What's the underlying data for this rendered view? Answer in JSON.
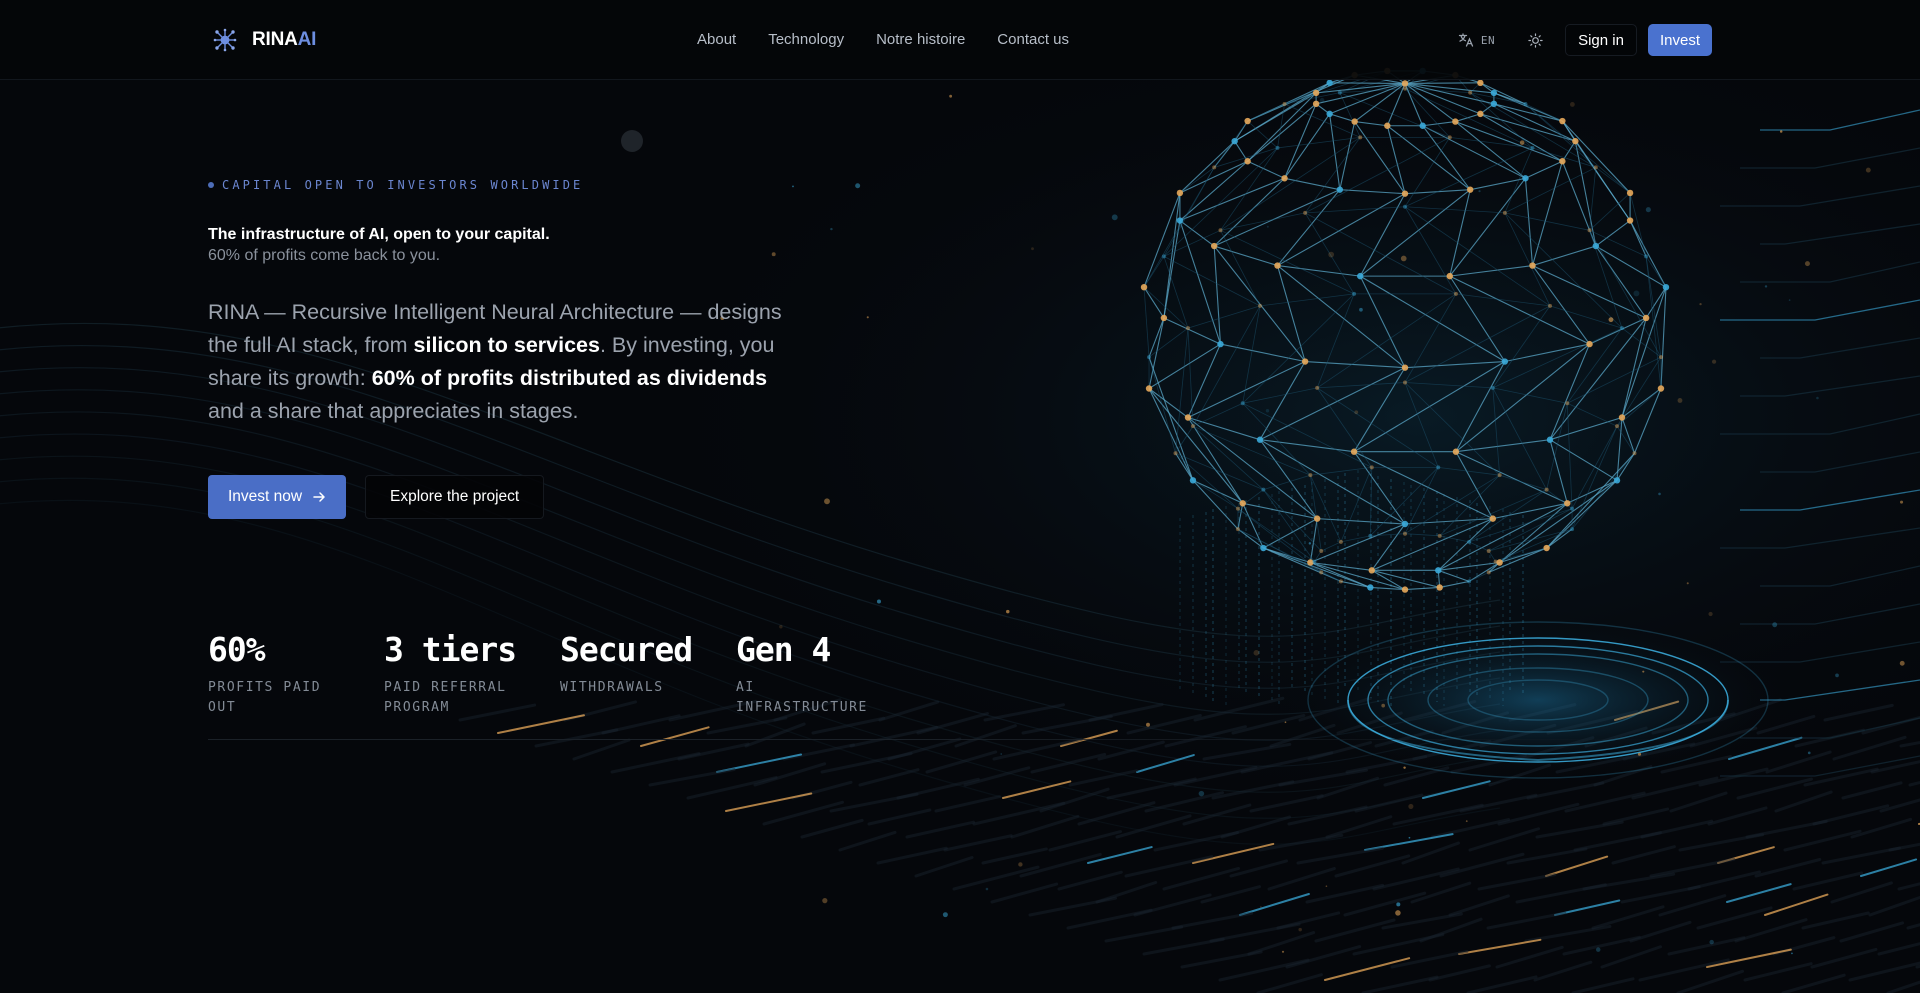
{
  "header": {
    "brand": {
      "name_main": "RINA",
      "name_accent": "AI",
      "logo_icon": "network-node-icon"
    },
    "nav": [
      {
        "label": "About"
      },
      {
        "label": "Technology"
      },
      {
        "label": "Notre histoire"
      },
      {
        "label": "Contact us"
      }
    ],
    "language": {
      "icon": "translate-icon",
      "code": "EN"
    },
    "theme_toggle_icon": "sun-icon",
    "sign_in_label": "Sign in",
    "invest_label": "Invest"
  },
  "hero": {
    "eyebrow": "CAPITAL OPEN TO INVESTORS WORLDWIDE",
    "headline_1": "The infrastructure of AI, open to your capital.",
    "headline_2": "60% of profits come back to you.",
    "lead": {
      "part_1": "RINA — Recursive Intelligent Neural Architecture — designs the full AI stack, from ",
      "highlight_1": "silicon to services",
      "part_2": ". By investing, you share its growth: ",
      "highlight_2": "60% of profits distributed as dividends",
      "part_3": " and a share that appreciates in stages."
    },
    "cta_primary": "Invest now",
    "cta_primary_icon": "arrow-right-icon",
    "cta_secondary": "Explore the project"
  },
  "stats": [
    {
      "value": "60%",
      "label": "PROFITS PAID OUT"
    },
    {
      "value": "3 tiers",
      "label": "PAID REFERRAL PROGRAM"
    },
    {
      "value": "Secured",
      "label": "WITHDRAWALS"
    },
    {
      "value": "Gen 4",
      "label": "AI INFRASTRUCTURE"
    }
  ],
  "colors": {
    "background": "#05070b",
    "accent": "#4a72cf",
    "accent_text": "#6d8ee0",
    "globe_cyan": "#3aa9d8",
    "node_amber": "#e8a95a"
  }
}
